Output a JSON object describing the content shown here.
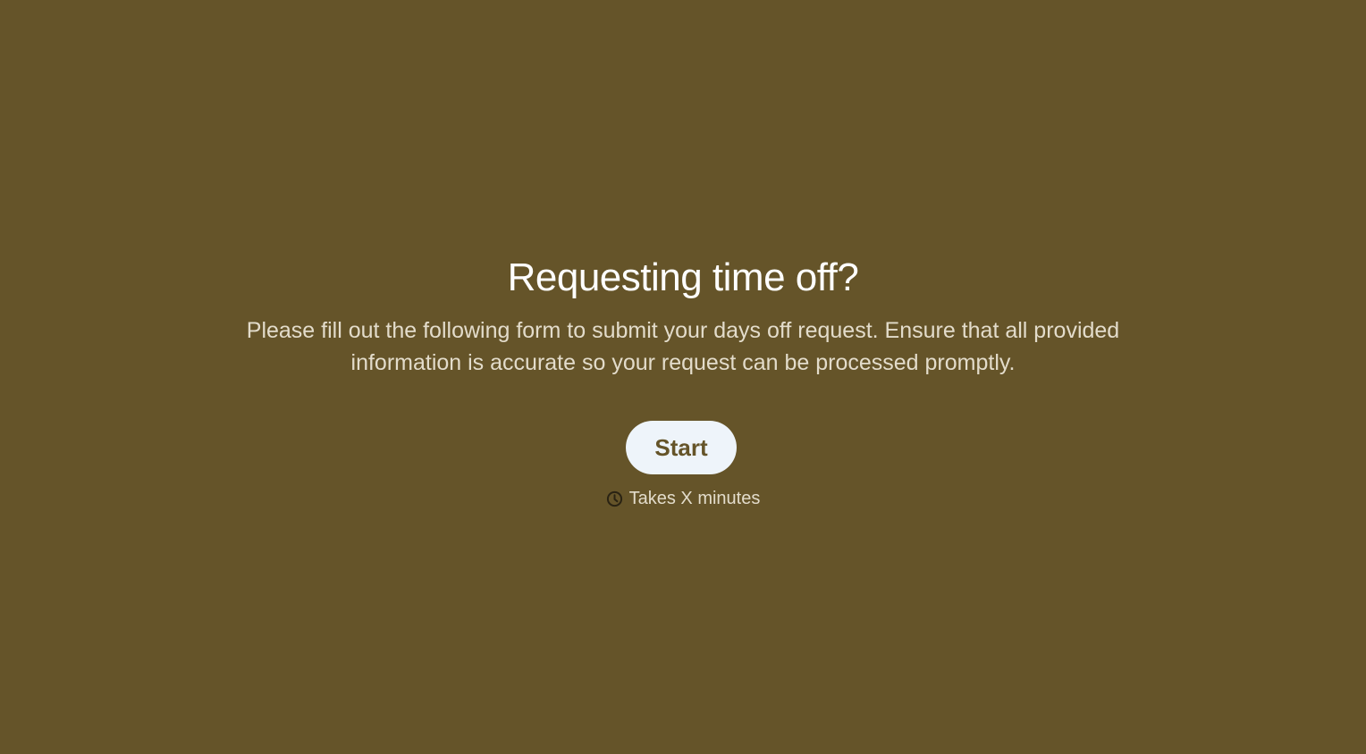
{
  "welcome": {
    "title": "Requesting time off?",
    "description": "Please fill out the following form to submit your days off request. Ensure that all provided information is accurate so your request can be processed promptly.",
    "start_button_label": "Start",
    "duration_text": "Takes X minutes",
    "duration_icon": "clock-icon"
  },
  "colors": {
    "background": "#655429",
    "button_background": "#eef4fa",
    "button_text": "#655429",
    "title_text": "#ffffff",
    "body_text": "#e3dccb"
  }
}
